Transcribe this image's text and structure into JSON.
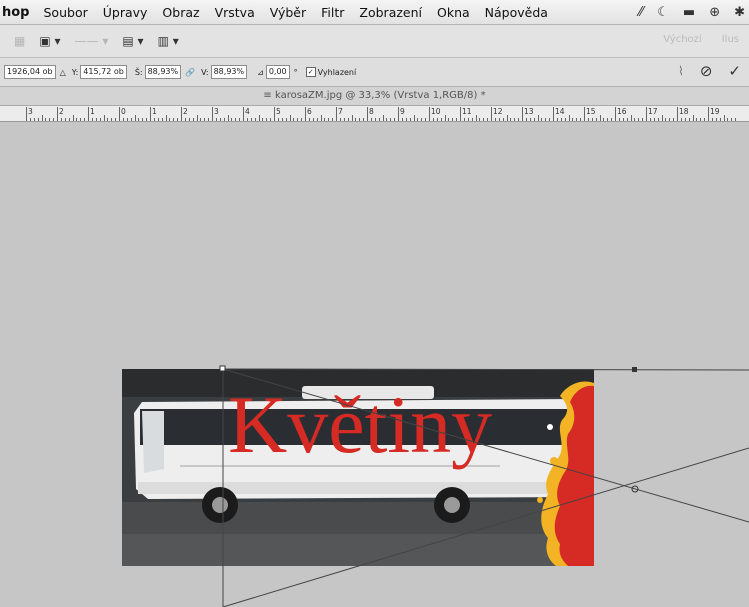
{
  "menubar": {
    "app": "hop",
    "items": [
      "Soubor",
      "Úpravy",
      "Obraz",
      "Vrstva",
      "Výběr",
      "Filtr",
      "Zobrazení",
      "Okna",
      "Nápověda"
    ],
    "status_icons": [
      "adobe-icon",
      "wifi-icon",
      "display-icon",
      "time-machine-icon",
      "bluetooth-icon"
    ]
  },
  "appbar": {
    "workspace": [
      "Výchozí",
      "Ilus"
    ]
  },
  "options": {
    "x_value": "1926,04 ob",
    "y_label": "Y:",
    "y_value": "415,72 ob",
    "w_label": "Š:",
    "w_value": "88,93%",
    "h_label": "V:",
    "h_value": "88,93%",
    "angle_value": "0,00",
    "angle_unit": "°",
    "antialias_label": "Vyhlazení",
    "antialias_checked": true
  },
  "document": {
    "tab_title": "karosaZM.jpg @ 33,3% (Vrstva 1,RGB/8) *",
    "zoom": "33,3%"
  },
  "ruler": {
    "labels": [
      "3",
      "2",
      "1",
      "0",
      "1",
      "2",
      "3",
      "4",
      "5",
      "6",
      "7",
      "8",
      "9",
      "10",
      "11",
      "12",
      "13",
      "14",
      "15",
      "16",
      "17",
      "18",
      "19"
    ]
  },
  "artwork": {
    "text": "Květiny",
    "text_color": "#d62a24",
    "splash_color": "#d62a24",
    "splash_edge_color": "#f2b324"
  },
  "colors": {
    "canvas_bg": "#c6c6c6",
    "menubar_bg": "#ececec"
  }
}
